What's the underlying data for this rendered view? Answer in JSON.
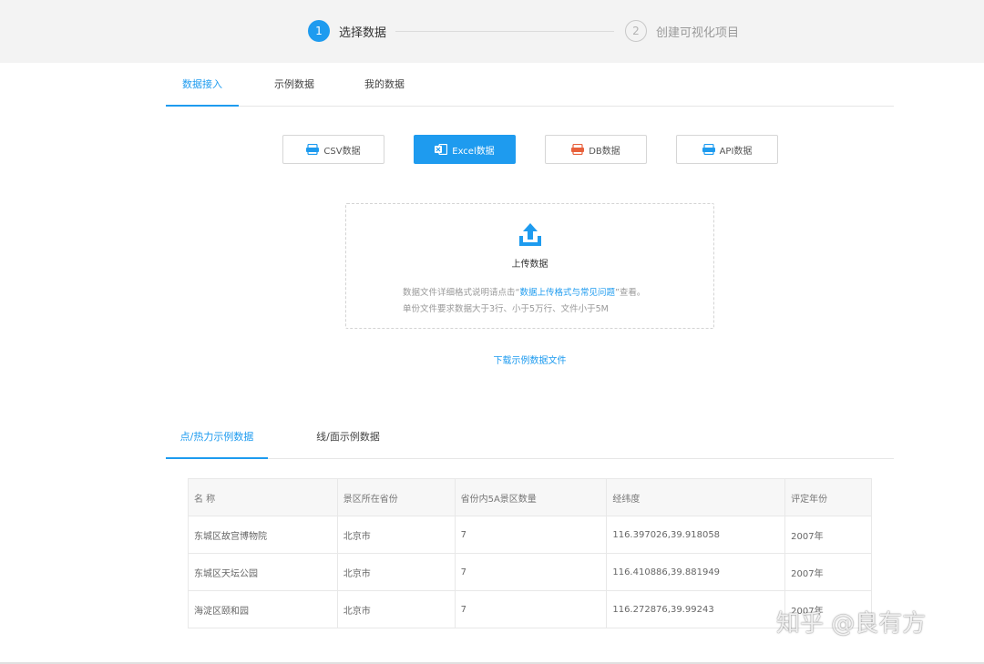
{
  "stepper": {
    "steps": [
      {
        "number": "1",
        "label": "选择数据"
      },
      {
        "number": "2",
        "label": "创建可视化项目"
      }
    ]
  },
  "tabs_top": [
    "数据接入",
    "示例数据",
    "我的数据"
  ],
  "sources": [
    {
      "label": "CSV数据",
      "icon": "csv-file-icon"
    },
    {
      "label": "Excel数据",
      "icon": "excel-file-icon"
    },
    {
      "label": "DB数据",
      "icon": "database-icon"
    },
    {
      "label": "API数据",
      "icon": "api-icon"
    }
  ],
  "upload": {
    "title": "上传数据",
    "note_prefix": "数据文件详细格式说明请点击“",
    "note_link": "数据上传格式与常见问题",
    "note_suffix": "”查看。",
    "note_line2": "单份文件要求数据大于3行、小于5万行、文件小于5M"
  },
  "download_label": "下载示例数据文件",
  "tabs_bottom": [
    "点/热力示例数据",
    "线/面示例数据"
  ],
  "table": {
    "headers": [
      "名 称",
      "景区所在省份",
      "省份内5A景区数量",
      "经纬度",
      "评定年份"
    ],
    "rows": [
      [
        "东城区故宫博物院",
        "北京市",
        "7",
        "116.397026,39.918058",
        "2007年"
      ],
      [
        "东城区天坛公园",
        "北京市",
        "7",
        "116.410886,39.881949",
        "2007年"
      ],
      [
        "海淀区颐和园",
        "北京市",
        "7",
        "116.272876,39.99243",
        "2007年"
      ]
    ]
  },
  "watermark": "知乎 @良有方",
  "colors": {
    "accent": "#1e9bef",
    "header_bg": "#f3f3f3"
  }
}
